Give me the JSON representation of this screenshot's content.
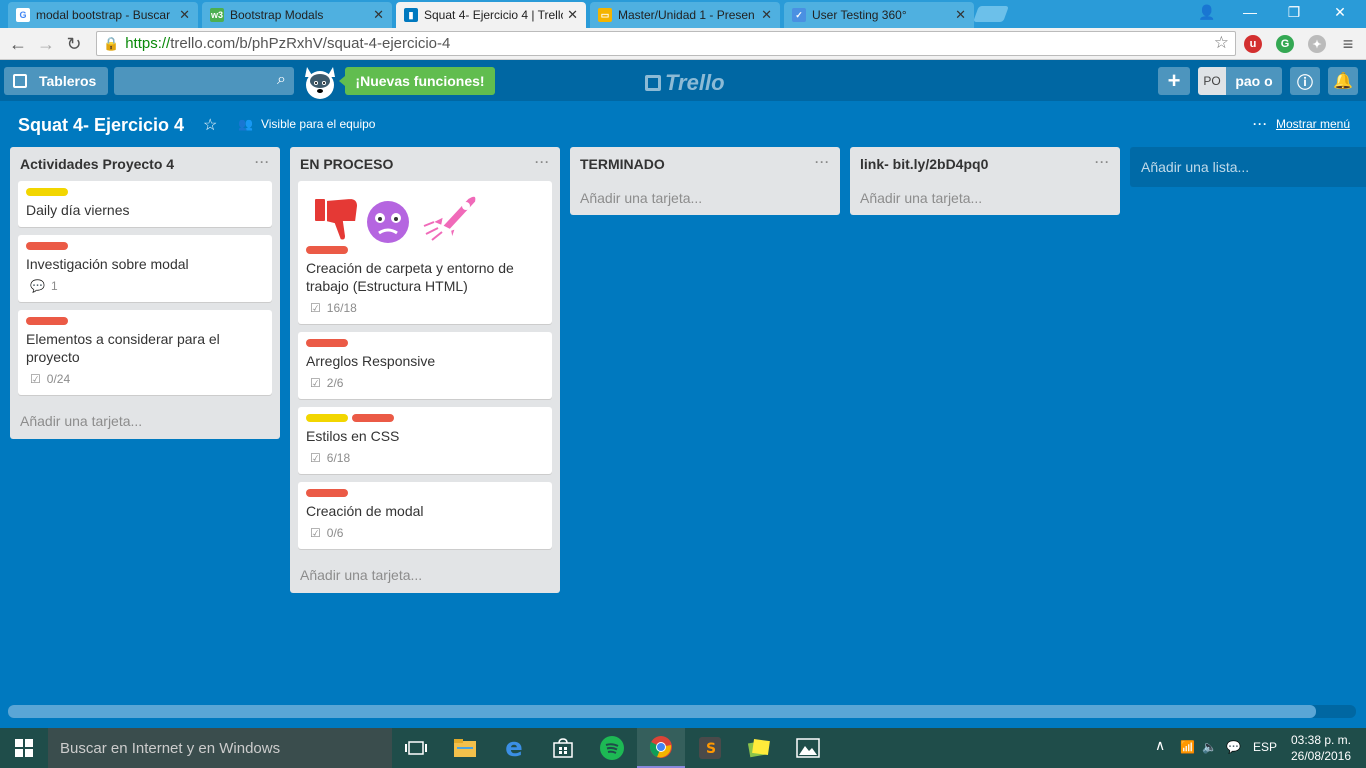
{
  "browser": {
    "tabs": [
      {
        "title": "modal bootstrap - Buscar",
        "icon": "google-icon"
      },
      {
        "title": "Bootstrap Modals",
        "icon": "w3-icon"
      },
      {
        "title": "Squat 4- Ejercicio 4 | Trello",
        "icon": "trello-icon",
        "active": true
      },
      {
        "title": "Master/Unidad 1 - Presen",
        "icon": "slides-icon"
      },
      {
        "title": "User Testing 360°",
        "icon": "checkbox-icon"
      }
    ],
    "url": {
      "scheme": "https://",
      "rest": "trello.com/b/phPzRxhV/squat-4-ejercicio-4"
    }
  },
  "trello_header": {
    "boards_label": "Tableros",
    "search_placeholder": "",
    "new_features": "¡Nuevas funciones!",
    "logo": "Trello",
    "avatar_initials": "PO",
    "username": "pao o"
  },
  "board": {
    "title": "Squat 4- Ejercicio 4",
    "visibility": "Visible para el equipo",
    "show_menu": "Mostrar menú",
    "add_list": "Añadir una lista...",
    "lists": [
      {
        "name": "Actividades Proyecto 4",
        "add_card": "Añadir una tarjeta...",
        "cards": [
          {
            "labels": [
              "yellow"
            ],
            "title": "Daily día viernes"
          },
          {
            "labels": [
              "red"
            ],
            "title": "Investigación sobre modal",
            "comments": "1"
          },
          {
            "labels": [
              "red"
            ],
            "title": "Elementos a considerar para el proyecto",
            "checklist": "0/24"
          }
        ]
      },
      {
        "name": "EN PROCESO",
        "add_card": "Añadir una tarjeta...",
        "cards": [
          {
            "labels": [
              "red"
            ],
            "title": "Creación de carpeta y entorno de trabajo (Estructura HTML)",
            "checklist": "16/18",
            "stickers": [
              "thumbs-down-sticker",
              "worried-face-sticker",
              "rocket-sticker"
            ]
          },
          {
            "labels": [
              "red"
            ],
            "title": "Arreglos Responsive",
            "checklist": "2/6"
          },
          {
            "labels": [
              "yellow",
              "red"
            ],
            "title": "Estilos en CSS",
            "checklist": "6/18"
          },
          {
            "labels": [
              "red"
            ],
            "title": "Creación de modal",
            "checklist": "0/6"
          }
        ]
      },
      {
        "name": "TERMINADO",
        "add_card": "Añadir una tarjeta...",
        "cards": []
      },
      {
        "name": "link- bit.ly/2bD4pq0",
        "add_card": "Añadir una tarjeta...",
        "cards": []
      }
    ]
  },
  "colors": {
    "board_bg": "#0079bf",
    "header_bg": "#0067a3",
    "label_yellow": "#f2d600",
    "label_red": "#eb5a46",
    "green": "#61bd4f"
  },
  "scroll": {
    "horizontal_fraction_visible": 0.97
  },
  "taskbar": {
    "search_placeholder": "Buscar en Internet y en Windows",
    "language": "ESP",
    "time": "03:38 p. m.",
    "date": "26/08/2016"
  }
}
